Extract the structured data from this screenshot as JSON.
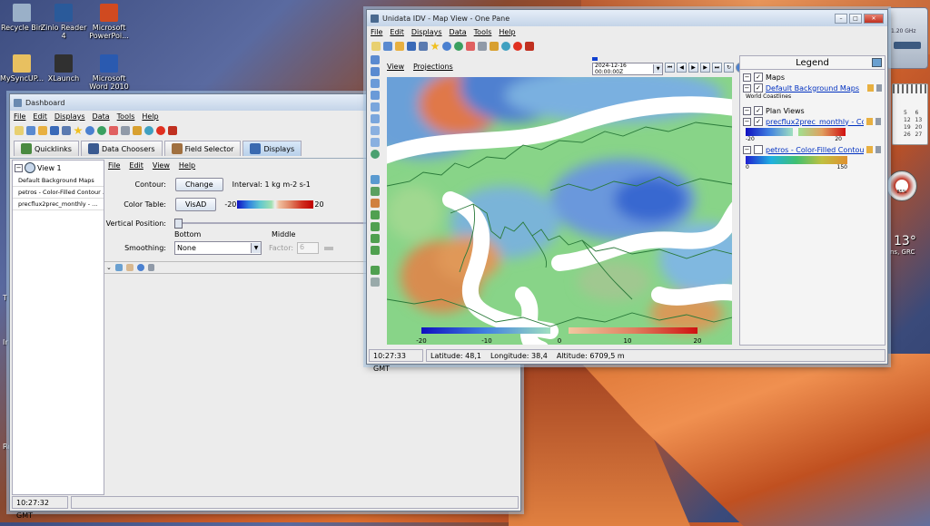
{
  "desktop": {
    "icons": [
      {
        "label": "Recycle Bin",
        "icon": "recycle-bin-icon",
        "color": "#9ab0c8"
      },
      {
        "label": "Zinio Reader\n4",
        "icon": "zinio-icon",
        "color": "#2a5a9a"
      },
      {
        "label": "Microsoft\nPowerPoi...",
        "icon": "powerpoint-icon",
        "color": "#d04a20"
      },
      {
        "label": "MySyncUP...",
        "icon": "folder-icon",
        "color": "#e8c060"
      },
      {
        "label": "XLaunch",
        "icon": "xlaunch-icon",
        "color": "#303030"
      },
      {
        "label": "Microsoft\nWord 2010",
        "icon": "word-icon",
        "color": "#2a5ab0"
      }
    ],
    "side_letters": [
      "T",
      "Ir",
      "Ro"
    ],
    "gadgets": {
      "cpu_text": "1.20 GHz",
      "calendar_numbers": [
        "5",
        "6",
        "12",
        "13",
        "19",
        "20",
        "26",
        "27"
      ],
      "meter_text": "85%",
      "temperature": "13°",
      "location": "ns, GRC"
    }
  },
  "dashboard": {
    "title": "Dashboard",
    "menu": [
      "File",
      "Edit",
      "Displays",
      "Data",
      "Tools",
      "Help"
    ],
    "tabs": [
      {
        "label": "Quicklinks",
        "icon": "quicklinks-icon",
        "selected": false
      },
      {
        "label": "Data Choosers",
        "icon": "data-choosers-icon",
        "selected": false
      },
      {
        "label": "Field Selector",
        "icon": "field-selector-icon",
        "selected": false
      },
      {
        "label": "Displays",
        "icon": "displays-icon",
        "selected": true
      }
    ],
    "tree": {
      "view_label": "View 1",
      "items": [
        "Default Background Maps",
        "petros - Color-Filled Contour ...",
        "precflux2prec_monthly - ..."
      ]
    },
    "submenu": [
      "File",
      "Edit",
      "View",
      "Help"
    ],
    "contour_label": "Contour:",
    "change_button": "Change",
    "interval_text": "Interval: 1 kg m-2 s-1",
    "color_table_label": "Color Table:",
    "visad_button": "VisAD",
    "ct_min": "-20",
    "ct_max": "20",
    "vertical_position_label": "Vertical Position:",
    "slider_bottom": "Bottom",
    "slider_middle": "Middle",
    "smoothing_label": "Smoothing:",
    "smoothing_value": "None",
    "factor_label": "Factor:",
    "factor_value": "6",
    "status_time": "10:27:32 GMT"
  },
  "mapview": {
    "title": "Unidata IDV - Map View - One Pane",
    "menu": [
      "File",
      "Edit",
      "Displays",
      "Data",
      "Tools",
      "Help"
    ],
    "view_menu": [
      "View",
      "Projections"
    ],
    "time_value": "2024-12-16 00:00:00Z",
    "colorbar_ticks": [
      "-20",
      "-10",
      "0",
      "10",
      "20"
    ],
    "legend": {
      "title": "Legend",
      "maps_header": "Maps",
      "background_maps": "Default Background Maps",
      "world_coastlines": "World Coastlines",
      "plan_header": "Plan Views",
      "layer1": "precflux2prec_monthly - Co...",
      "layer1_min": "-20",
      "layer1_max": "20",
      "layer2": "petros - Color-Filled Contour...",
      "layer2_min": "0",
      "layer2_max": "150"
    },
    "status": {
      "time": "10:27:33 GMT",
      "latitude": "Latitude:  48,1",
      "longitude": "Longitude:  38,4",
      "altitude": "Altitude:  6709,5 m"
    }
  },
  "colors": {
    "accent": "#0030c0",
    "map_blue": "#4a70d8",
    "map_green": "#80d880",
    "map_red": "#e06040"
  }
}
